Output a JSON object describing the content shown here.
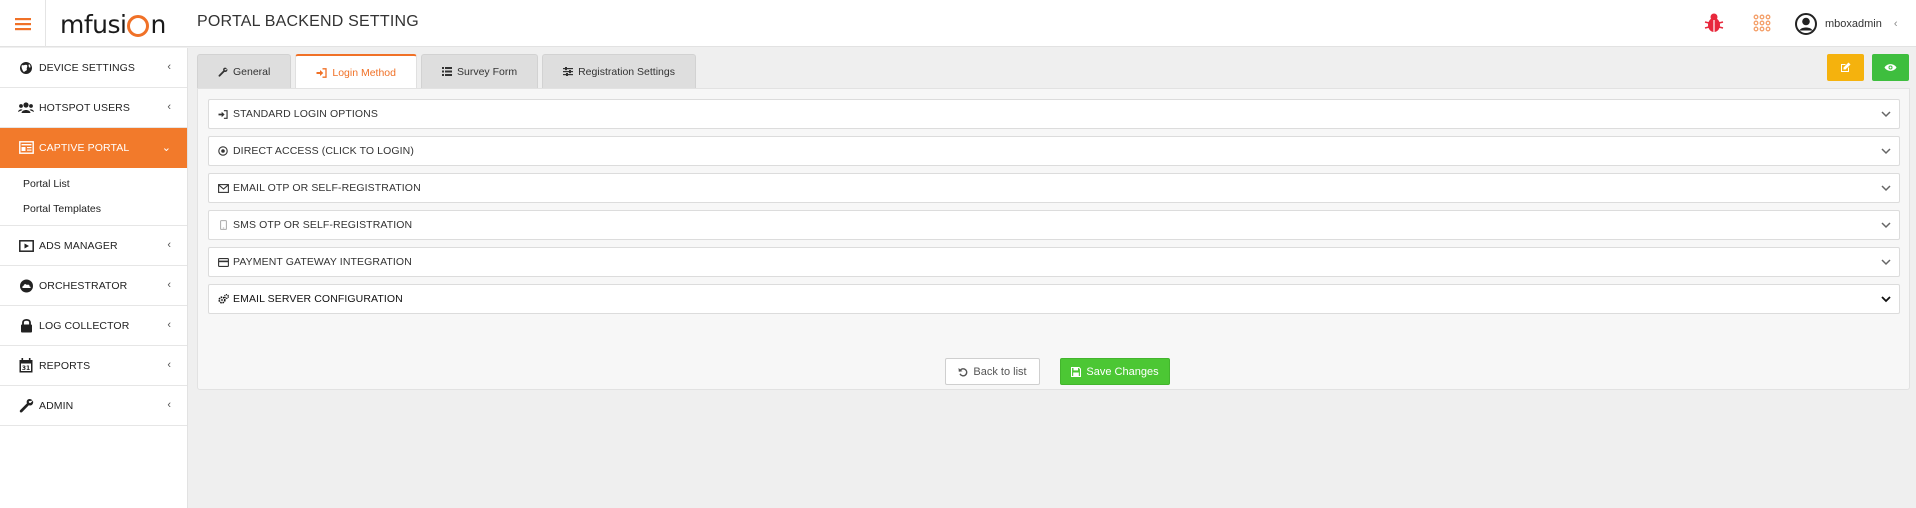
{
  "header": {
    "logo_text_pre": "mfusi",
    "logo_text_post": "n",
    "title": "PORTAL BACKEND SETTING",
    "username": "mboxadmin",
    "user_chevron": "‹"
  },
  "sidebar": {
    "items": [
      {
        "label": "DEVICE SETTINGS",
        "icon": "globe-icon",
        "chevron": "‹"
      },
      {
        "label": "HOTSPOT USERS",
        "icon": "users-icon",
        "chevron": "‹"
      },
      {
        "label": "CAPTIVE PORTAL",
        "icon": "portal-icon",
        "chevron": "⌄",
        "active": true
      },
      {
        "label": "ADS MANAGER",
        "icon": "play-icon",
        "chevron": "‹"
      },
      {
        "label": "ORCHESTRATOR",
        "icon": "cloud-icon",
        "chevron": "‹"
      },
      {
        "label": "LOG COLLECTOR",
        "icon": "lock-icon",
        "chevron": "‹"
      },
      {
        "label": "REPORTS",
        "icon": "calendar-icon",
        "chevron": "‹"
      },
      {
        "label": "ADMIN",
        "icon": "wrench-icon",
        "chevron": "‹"
      }
    ],
    "submenu": [
      "Portal List",
      "Portal Templates"
    ]
  },
  "tabs": [
    {
      "label": "General",
      "icon": "wrench-icon"
    },
    {
      "label": "Login Method",
      "icon": "sign-in-icon",
      "active": true
    },
    {
      "label": "Survey Form",
      "icon": "list-icon"
    },
    {
      "label": "Registration Settings",
      "icon": "sliders-icon"
    }
  ],
  "accordion": [
    {
      "label": "STANDARD LOGIN OPTIONS",
      "icon": "sign-in-icon"
    },
    {
      "label": "DIRECT ACCESS (CLICK TO LOGIN)",
      "icon": "target-icon"
    },
    {
      "label": "EMAIL OTP OR SELF-REGISTRATION",
      "icon": "envelope-icon"
    },
    {
      "label": "SMS OTP OR SELF-REGISTRATION",
      "icon": "mobile-icon"
    },
    {
      "label": "PAYMENT GATEWAY INTEGRATION",
      "icon": "credit-card-icon"
    },
    {
      "label": "EMAIL SERVER CONFIGURATION",
      "icon": "cogs-icon"
    }
  ],
  "actions": {
    "back_label": "Back to list",
    "save_label": "Save Changes"
  },
  "colors": {
    "accent": "#f27a2b",
    "save_green": "#4cc734",
    "edit_yellow": "#f5b20d",
    "view_green": "#3ebe3e",
    "bug_red": "#e8283c"
  }
}
